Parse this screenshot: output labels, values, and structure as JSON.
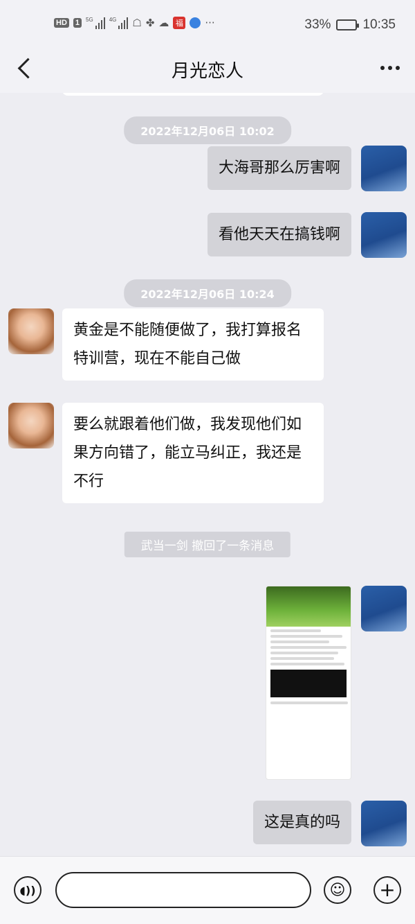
{
  "status_bar": {
    "badge_hd": "HD",
    "badge_1": "1",
    "signal1_label": "5G",
    "signal2_label": "4G",
    "more": "···",
    "battery_percent": "33%",
    "battery_level": 0.33,
    "time": "10:35"
  },
  "header": {
    "title": "月光恋人"
  },
  "messages": [
    {
      "type": "time",
      "text": "2022年12月06日 10:02"
    },
    {
      "type": "text",
      "sender": "me",
      "text": "大海哥那么厉害啊"
    },
    {
      "type": "text",
      "sender": "me",
      "text": "看他天天在搞钱啊"
    },
    {
      "type": "time",
      "text": "2022年12月06日 10:24"
    },
    {
      "type": "text",
      "sender": "her",
      "text": "黄金是不能随便做了，我打算报名特训营，现在不能自己做"
    },
    {
      "type": "text",
      "sender": "her",
      "text": "要么就跟着他们做，我发现他们如果方向错了，能立马纠正，我还是不行"
    },
    {
      "type": "recall",
      "text": "武当一剑 撤回了一条消息"
    },
    {
      "type": "image",
      "sender": "me"
    },
    {
      "type": "text",
      "sender": "me",
      "text": "这是真的吗"
    }
  ],
  "colors": {
    "chat_bg": "#ededf2",
    "my_bubble": "#d3d3d8",
    "their_bubble": "#ffffff",
    "pill_bg": "#d3d3d9"
  },
  "icons": {
    "back": "back-chevron-icon",
    "more": "more-dots-icon",
    "voice": "voice-icon",
    "emoji": "emoji-icon",
    "plus": "plus-icon"
  }
}
